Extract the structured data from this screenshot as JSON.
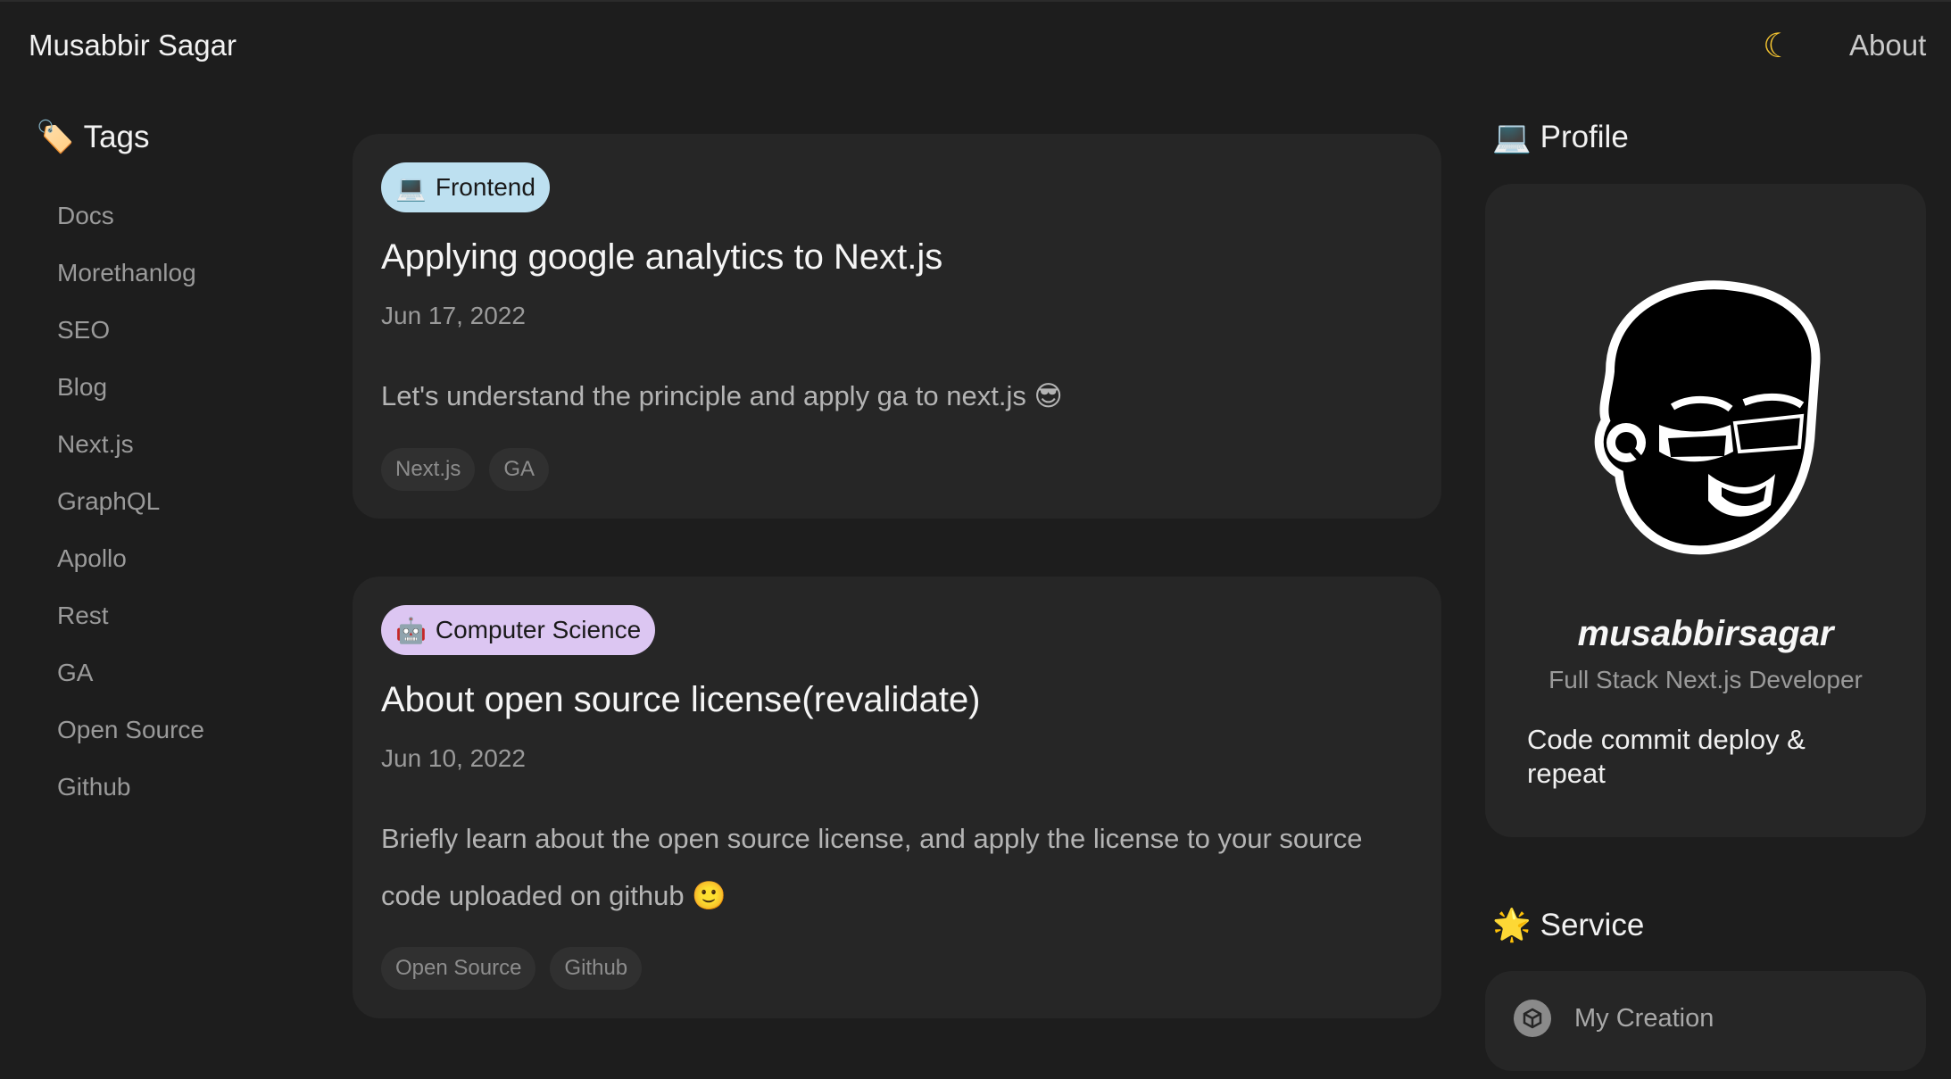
{
  "header": {
    "brand": "Musabbir Sagar",
    "about": "About",
    "theme_icon": "moon-icon"
  },
  "sidebar": {
    "title_emoji": "🏷️",
    "title": "Tags",
    "items": [
      {
        "label": "Docs"
      },
      {
        "label": "Morethanlog"
      },
      {
        "label": "SEO"
      },
      {
        "label": "Blog"
      },
      {
        "label": "Next.js"
      },
      {
        "label": "GraphQL"
      },
      {
        "label": "Apollo"
      },
      {
        "label": "Rest"
      },
      {
        "label": "GA"
      },
      {
        "label": "Open Source"
      },
      {
        "label": "Github"
      }
    ]
  },
  "posts": [
    {
      "category_emoji": "💻",
      "category": "Frontend",
      "category_color": "#bde0f0",
      "title": "Applying google analytics to Next.js",
      "date": "Jun 17, 2022",
      "summary": "Let's understand the principle and apply ga to next.js 😎",
      "tags": [
        "Next.js",
        "GA"
      ]
    },
    {
      "category_emoji": "🤖",
      "category": "Computer Science",
      "category_color": "#dcc6f2",
      "title": "About open source license(revalidate)",
      "date": "Jun 10, 2022",
      "summary": "Briefly learn about the open source license, and apply the license to your source code uploaded on github 🙂",
      "tags": [
        "Open Source",
        "Github"
      ]
    }
  ],
  "profile": {
    "title_emoji": "💻",
    "title": "Profile",
    "name": "musabbirsagar",
    "role": "Full Stack Next.js Developer",
    "motto": "Code commit deploy & repeat"
  },
  "service": {
    "title_emoji": "🌟",
    "title": "Service",
    "items": [
      {
        "label": "My Creation",
        "icon": "cube-icon"
      }
    ]
  }
}
